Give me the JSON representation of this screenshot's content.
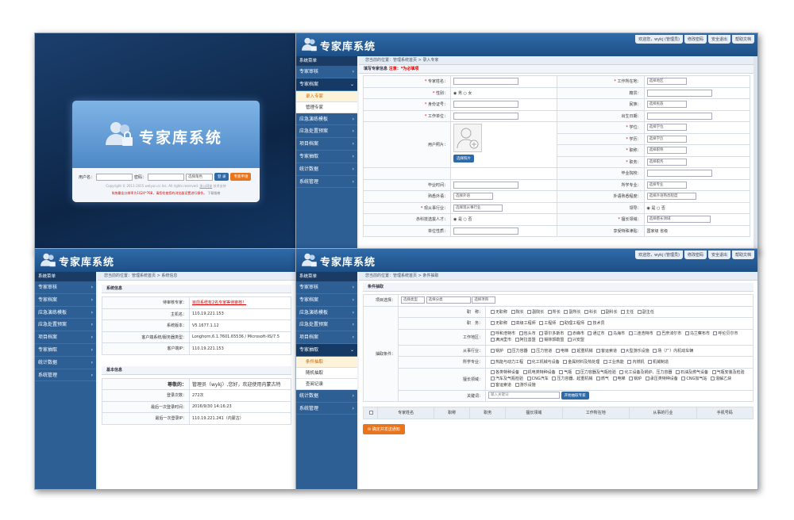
{
  "app_title": "专家库系统",
  "top_links": [
    "欢迎您，wykj (管理员)",
    "修改密码",
    "安全退出",
    "帮助文档"
  ],
  "login": {
    "user_label": "用户名：",
    "pwd_label": "密码：",
    "role_select": "选择角色",
    "login_btn": "登 录",
    "register_btn": "专家申请",
    "copyright": "Copyright © 2011-2015 welyun.cc Inc. All rights reserved.",
    "copyright_links": [
      "浙公网安",
      "技术支持"
    ],
    "notice": "系统最佳分辨率为1024*768，请您检查您的浏览器设置进行操作。",
    "notice_link": "下载指南"
  },
  "sidebar_title": "系统菜单",
  "s2": {
    "crumb": "您当前的位置：管理系统首页 > 录入专家",
    "menu": [
      "专家审核",
      "专家档案",
      "应急演练模板",
      "应急处置预案",
      "项目档案",
      "专家抽取",
      "统计数据",
      "系统管理"
    ],
    "submenu": [
      "录入专家",
      "管理专家"
    ],
    "form_title": "填写专家信息",
    "form_note": "注意：*为必填项",
    "rows": [
      {
        "l": "专家姓名：",
        "req": true,
        "v": "",
        "l2": "工作所在地：",
        "req2": true,
        "v2": "选择地区"
      },
      {
        "l": "性别：",
        "req": true,
        "v": "◉ 男  ○ 女",
        "l2": "籍贯：",
        "req2": false,
        "v2": ""
      },
      {
        "l": "身份证号：",
        "req": true,
        "v": "",
        "l2": "民族：",
        "req2": false,
        "v2": "选择民族"
      },
      {
        "l": "工作单位：",
        "req": true,
        "v": "",
        "l2": "出生日期：",
        "req2": false,
        "v2": ""
      },
      {
        "l": "学位：",
        "req": true,
        "v": "选择学位",
        "l2": "学历：",
        "req2": true,
        "v2": "选择学历"
      },
      {
        "l": "职称：",
        "req": true,
        "v": "选择职称",
        "l2": "职务：",
        "req2": true,
        "v2": "选择职务"
      },
      {
        "l": "毕业院校：",
        "req": false,
        "v": ""
      }
    ],
    "photo_label": "用户照片：",
    "photo_btn": "选择照片",
    "rows_b": [
      {
        "l": "毕业时间：",
        "req": false,
        "v": "",
        "l2": "所学专业：",
        "req2": false,
        "v2": "选择专业"
      },
      {
        "l": "熟悉外语：",
        "req": false,
        "v": "选择外语",
        "l2": "外语熟悉程度：",
        "req2": false,
        "v2": "选择外语熟悉程度"
      },
      {
        "l": "现从事行业：",
        "req": true,
        "v": "选择现从事行业",
        "l2": "领导：",
        "req2": false,
        "v2": "◉ 是  ○ 否"
      },
      {
        "l": "赤科技选拔人才：",
        "req": false,
        "v": "◉ 是  ○ 否",
        "l2": "擅长领域：",
        "req2": true,
        "v2": "选择擅长领域"
      },
      {
        "l": "单位性质：",
        "req": false,
        "v": "",
        "l2": "享受特殊津贴：",
        "req2": false,
        "v2": "国家级  省级"
      }
    ]
  },
  "s3": {
    "crumb": "您当前的位置：管理系统首页 > 系统信息",
    "menu": [
      "专家审核",
      "专家档案",
      "应急演练模板",
      "应急处置预案",
      "项目档案",
      "专家抽取",
      "统计数据",
      "系统管理"
    ],
    "sec1": "系统信息",
    "info": [
      {
        "l": "待审核专家：",
        "v": "目前系统有2名专家等待审核！"
      },
      {
        "l": "主机名：",
        "v": "110.19.221.153"
      },
      {
        "l": "系统版本：",
        "v": "V5.1677.1.12"
      },
      {
        "l": "客户端系统/服务器类型：",
        "v": "Longhorn,6.1.7601.65536 / Microsoft-IIS/7.5"
      },
      {
        "l": "客户端IP：",
        "v": "110.19.221.153"
      }
    ],
    "sec2": "基本信息",
    "greet_l": "尊敬的：",
    "greet_v": "管理员（wykj）,您好，欢迎使用内蒙古特",
    "basic": [
      {
        "l": "登录次数：",
        "v": "272次"
      },
      {
        "l": "最后一次登录时间：",
        "v": "2016/9/30 14:16:23"
      },
      {
        "l": "最后一次登录IP：",
        "v": "110.19.221.241（内蒙古）"
      }
    ]
  },
  "s4": {
    "crumb": "您当前的位置：管理系统首页 > 条件抽取",
    "menu_top": [
      "专家审核",
      "专家档案",
      "应急演练模板",
      "应急处置预案",
      "项目档案",
      "专家抽取"
    ],
    "submenu": [
      "条件抽取",
      "随机抽取",
      "查阅记录"
    ],
    "menu_bottom": [
      "统计数据",
      "系统管理"
    ],
    "sec": "条件抽取",
    "proj_label": "项目选择：",
    "proj_selects": [
      "选择类型",
      "选择分类",
      "选择项目"
    ],
    "cond_label": "抽取条件：",
    "titles_label": "职　称：",
    "titles": [
      "无职称",
      "院长",
      "副院长",
      "所长",
      "副所长",
      "科长",
      "副科长",
      "主任",
      "副主任"
    ],
    "duty_label": "职　务：",
    "duty": [
      "无职称",
      "高级工程师",
      "工程师",
      "助理工程师",
      "技术员"
    ],
    "area_label": "工作地区：",
    "area": [
      "呼和浩特市",
      "包头市",
      "鄂尔多斯市",
      "赤峰市",
      "通辽市",
      "乌海市",
      "二连浩特市",
      "巴彦淖尔市",
      "乌兰察布市",
      "呼伦贝尔市",
      "满洲里市",
      "阿拉善盟",
      "锡林郭勒盟",
      "兴安盟"
    ],
    "industry_label": "从事行业：",
    "industry": [
      "锅炉",
      "压力容器",
      "压力管道",
      "电梯",
      "起重机械",
      "客运索道",
      "大型游乐设施",
      "场（厂）内机动车辆"
    ],
    "major_label": "所学专业：",
    "major": [
      "热能与动力工程",
      "化工机械与设备",
      "金属材料及热处理",
      "工业热能",
      "内燃机",
      "机械制造"
    ],
    "domain_label": "擅长领域：",
    "domain": [
      "各类特种设备",
      "机电类特种设备",
      "气瓶",
      "压力容器及气瓶检验",
      "化工设备及锅炉、压力容器",
      "石油及燃气设备",
      "气瓶安装及检验",
      "汽车及气瓶检验",
      "CNG汽车",
      "压力容器、起重机械",
      "燃气",
      "电梯",
      "锅炉",
      "承压类特种设备",
      "CNG加气站",
      "混解乙炔",
      "客运索道",
      "游乐设施"
    ],
    "kw_label": "关键词：",
    "kw_placeholder": "输入关键词",
    "kw_btn": "开始抽取专家",
    "table_headers": [
      "专家姓名",
      "职称",
      "职务",
      "擅长领域",
      "工作所在地",
      "从事的行业",
      "手机号码"
    ],
    "confirm_btn": "确定并发送通知"
  }
}
